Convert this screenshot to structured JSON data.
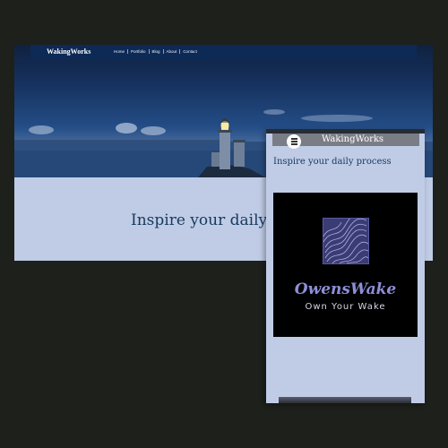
{
  "desktop": {
    "brand": "WakingWorks",
    "nav": [
      "Home",
      "Portfolio",
      "Blog",
      "About",
      "Contact"
    ],
    "tagline": "Inspire your daily p"
  },
  "mobile": {
    "brand": "WakingWorks",
    "tagline": "Inspire your daily process",
    "logo": {
      "name": "OwensWake",
      "slogan": "Own Your Wake"
    }
  },
  "colors": {
    "page_bg": "#1e201b",
    "nav_bar": "#0d2a56",
    "content_bg": "#c0cce6",
    "heading_text": "#163a5e",
    "logo_name": "#8e8fd8",
    "logo_bg": "#000000"
  },
  "icons": [
    "menu-icon",
    "owenswake-logo-icon"
  ]
}
